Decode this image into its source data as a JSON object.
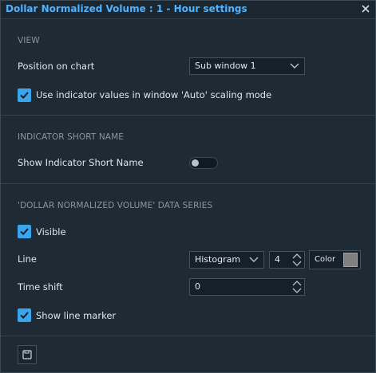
{
  "dialog": {
    "title": "Dollar Normalized Volume : 1 - Hour settings"
  },
  "view": {
    "header": "VIEW",
    "position_label": "Position on chart",
    "position_value": "Sub window 1",
    "auto_scaling_label": "Use indicator values in window 'Auto' scaling mode",
    "auto_scaling_checked": true
  },
  "short_name": {
    "header": "INDICATOR SHORT NAME",
    "show_label": "Show Indicator Short Name",
    "show_enabled": false
  },
  "data_series": {
    "header": "'DOLLAR NORMALIZED VOLUME' DATA SERIES",
    "visible_label": "Visible",
    "visible_checked": true,
    "line_label": "Line",
    "line_type": "Histogram",
    "line_width": "4",
    "color_label": "Color",
    "color_value": "#808080",
    "time_shift_label": "Time shift",
    "time_shift_value": "0",
    "marker_label": "Show line marker",
    "marker_checked": true
  },
  "colors": {
    "accent": "#3aa4ec",
    "title": "#4fb3ff",
    "background": "#1f2b34"
  },
  "icons": {
    "close": "close-icon",
    "save": "save-icon"
  }
}
